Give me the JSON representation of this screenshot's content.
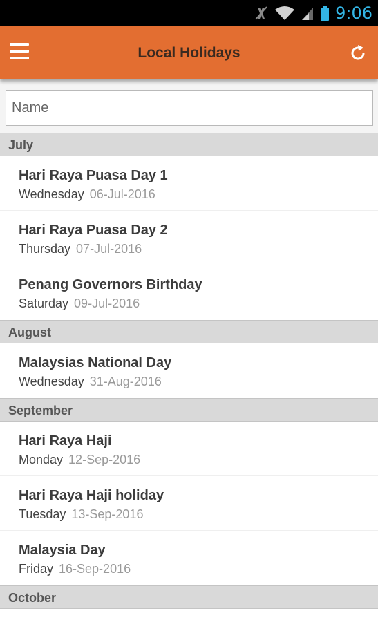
{
  "status_bar": {
    "time": "9:06",
    "icons": [
      "mute-icon",
      "wifi-icon",
      "signal-icon",
      "battery-icon"
    ]
  },
  "app_bar": {
    "title": "Local Holidays",
    "color": "#e36e31",
    "menu_icon": "hamburger-menu-icon",
    "refresh_icon": "refresh-icon"
  },
  "search": {
    "placeholder": "Name",
    "value": ""
  },
  "sections": [
    {
      "month": "July",
      "holidays": [
        {
          "name": "Hari Raya Puasa Day 1",
          "day": "Wednesday",
          "date": "06-Jul-2016"
        },
        {
          "name": "Hari Raya Puasa Day 2",
          "day": "Thursday",
          "date": "07-Jul-2016"
        },
        {
          "name": "Penang Governors Birthday",
          "day": "Saturday",
          "date": "09-Jul-2016"
        }
      ]
    },
    {
      "month": "August",
      "holidays": [
        {
          "name": "Malaysias National Day",
          "day": "Wednesday",
          "date": "31-Aug-2016"
        }
      ]
    },
    {
      "month": "September",
      "holidays": [
        {
          "name": "Hari Raya Haji",
          "day": "Monday",
          "date": "12-Sep-2016"
        },
        {
          "name": "Hari Raya Haji holiday",
          "day": "Tuesday",
          "date": "13-Sep-2016"
        },
        {
          "name": "Malaysia Day",
          "day": "Friday",
          "date": "16-Sep-2016"
        }
      ]
    },
    {
      "month": "October",
      "holidays": []
    }
  ]
}
